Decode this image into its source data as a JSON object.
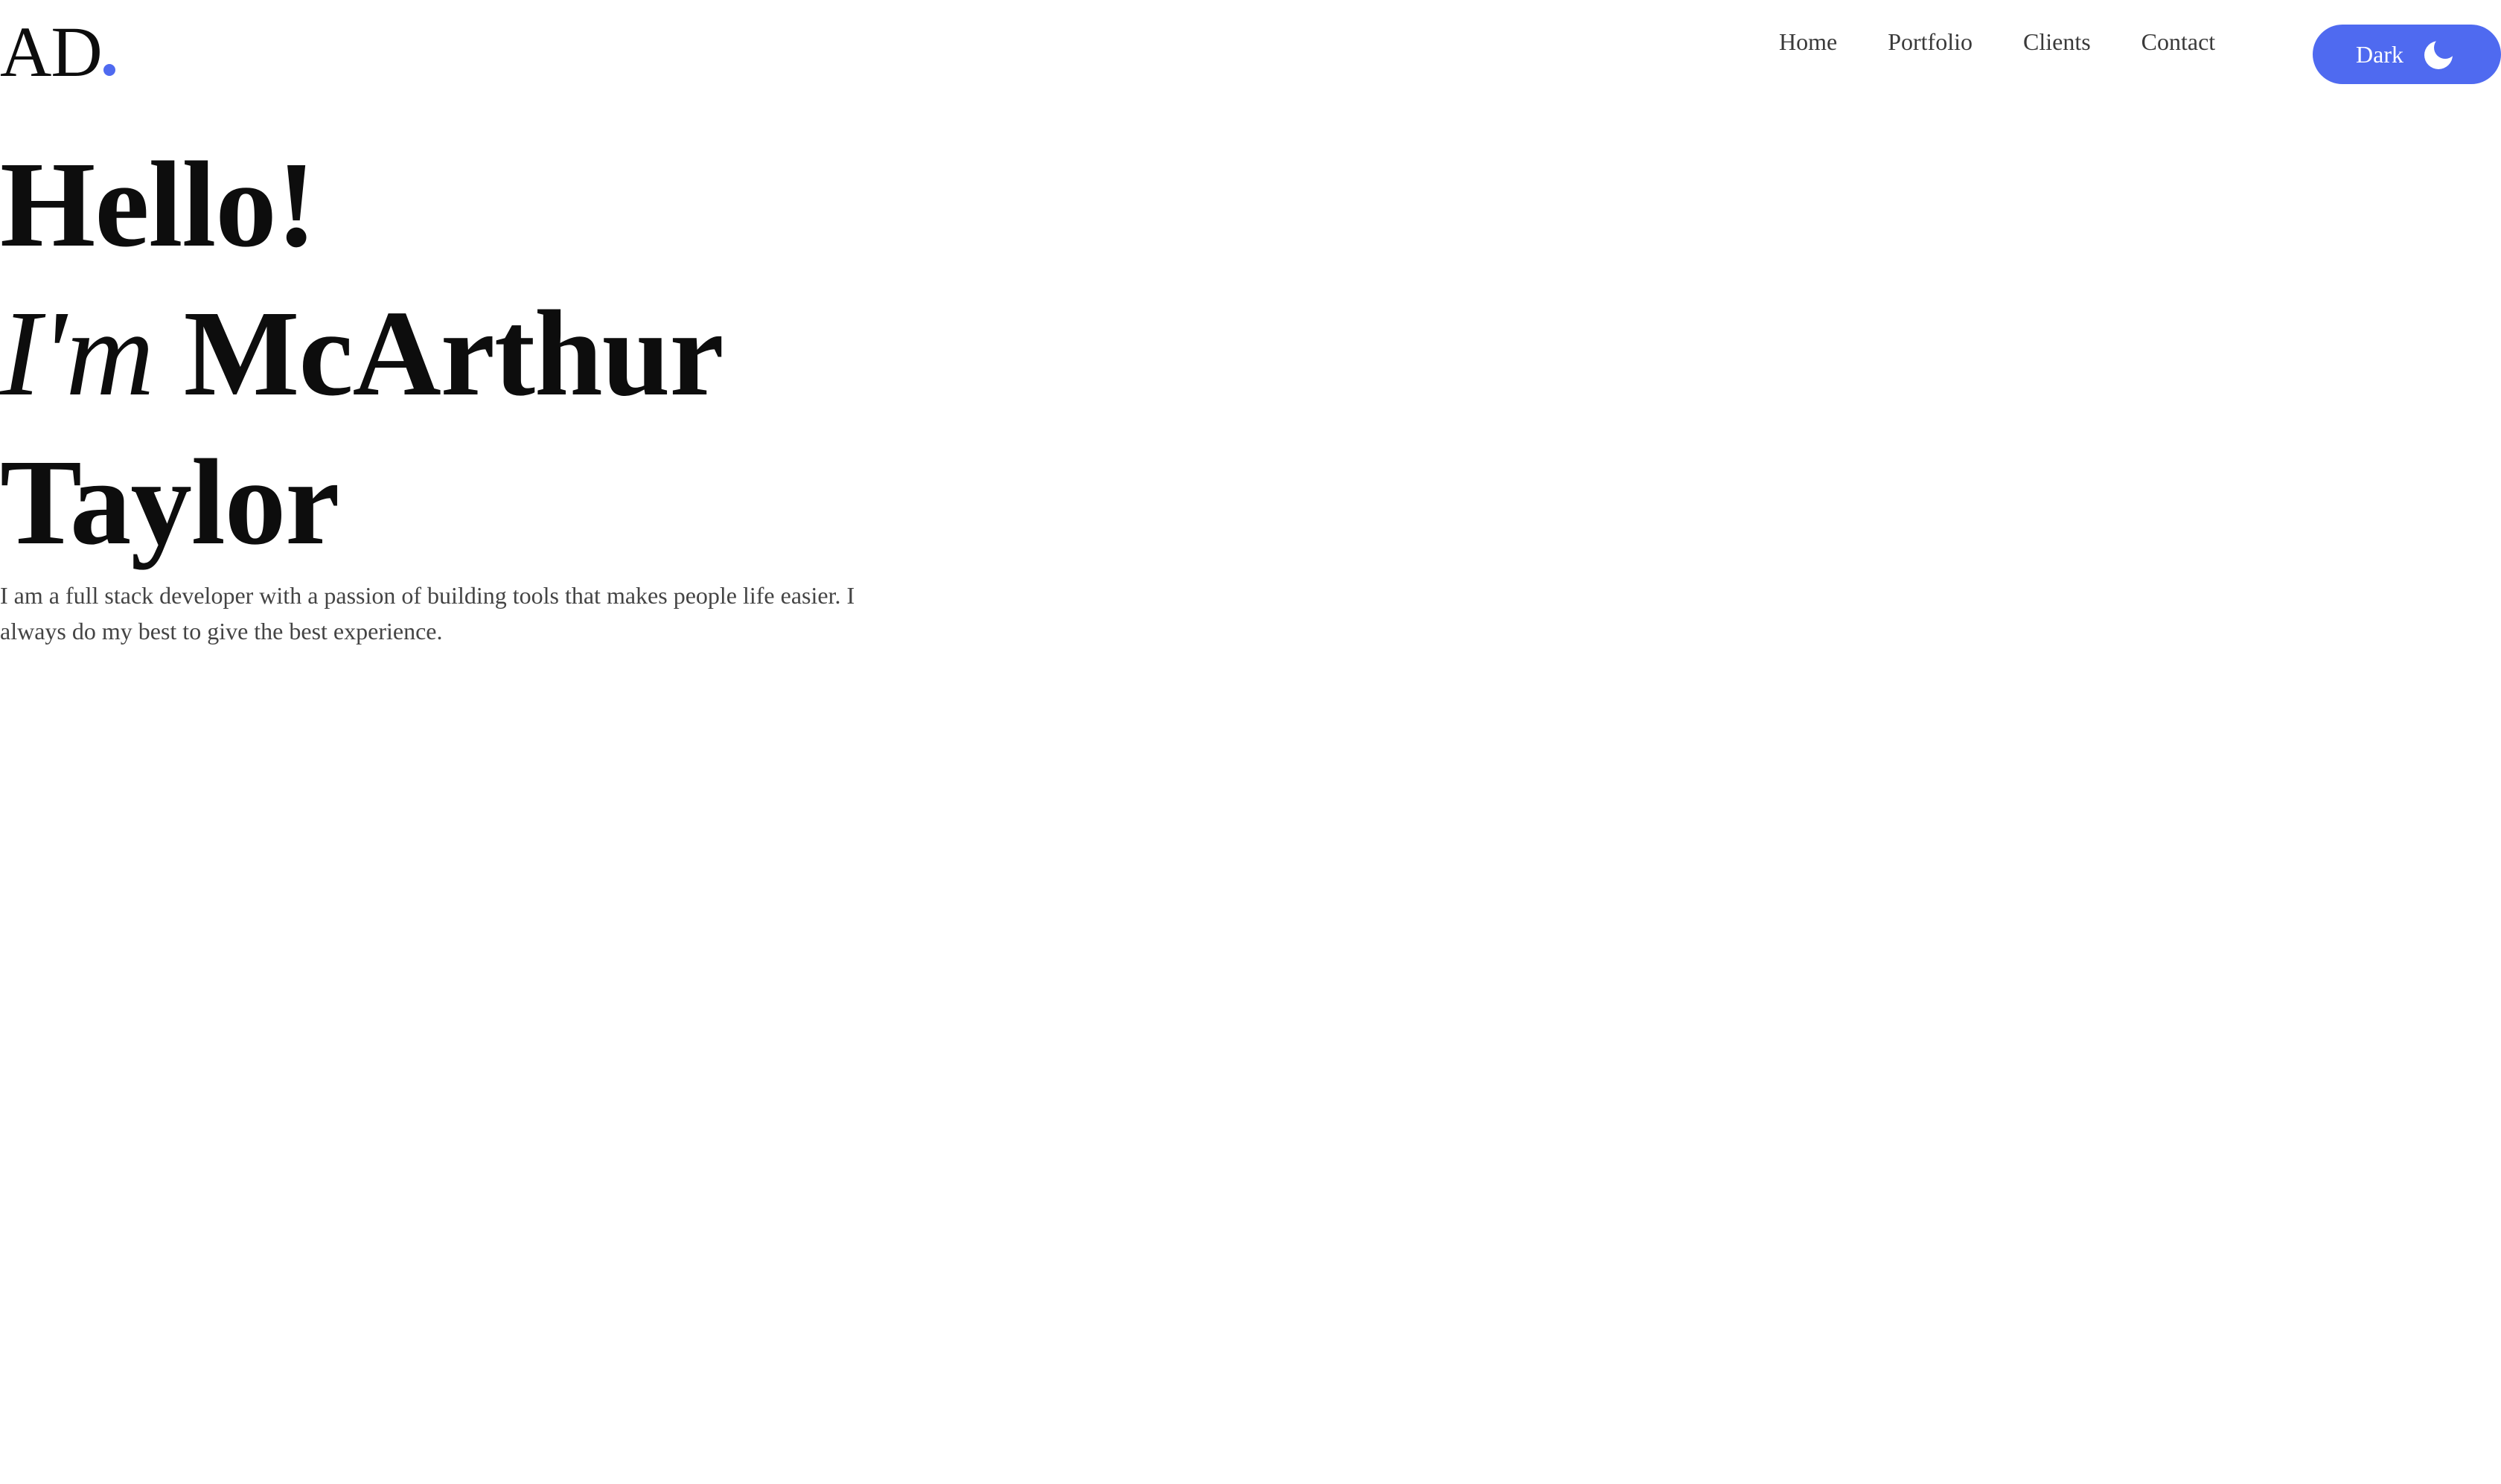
{
  "header": {
    "logo_text": "AD",
    "nav": [
      {
        "label": "Home"
      },
      {
        "label": "Portfolio"
      },
      {
        "label": "Clients"
      },
      {
        "label": "Contact"
      }
    ],
    "theme_toggle": {
      "label": "Dark",
      "icon": "moon-icon"
    }
  },
  "hero": {
    "greeting": "Hello!",
    "intro_prefix": "I'm",
    "first_name": "McArthur",
    "last_name": "Taylor",
    "description": "I am a full stack developer with a passion of building tools that makes people life easier. I always do my best to give the best experience."
  },
  "colors": {
    "accent": "#4f6af0",
    "text": "#0d0d0d",
    "muted_text": "#444444",
    "background": "#ffffff"
  }
}
